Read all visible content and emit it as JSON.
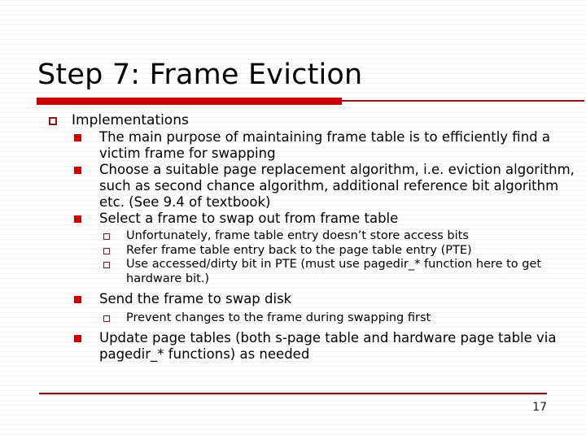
{
  "slide": {
    "title": "Step 7: Frame Eviction",
    "page_number": "17",
    "accent_color": "#CC0000",
    "rule_color": "#8C1616",
    "text_color": "#000000",
    "background_color": "#FFFFFF"
  },
  "bullets": {
    "b1": {
      "level": 1,
      "marker": "hollow-square",
      "text": "Implementations"
    },
    "b2": {
      "level": 2,
      "marker": "filled-square",
      "text": "The main purpose of maintaining frame table is to efficiently find a victim frame for swapping"
    },
    "b3": {
      "level": 2,
      "marker": "filled-square",
      "text": "Choose a suitable page replacement algorithm, i.e. eviction algorithm, such as second chance algorithm, additional reference bit algorithm etc. (See 9.4 of textbook)"
    },
    "b4": {
      "level": 2,
      "marker": "filled-square",
      "text": "Select a frame to swap out from frame table"
    },
    "b5": {
      "level": 3,
      "marker": "hollow-square",
      "text": "Unfortunately, frame table entry doesn’t store access bits"
    },
    "b6": {
      "level": 3,
      "marker": "hollow-square",
      "text": "Refer frame table entry back to the page table entry (PTE)"
    },
    "b7": {
      "level": 3,
      "marker": "hollow-square",
      "text": "Use accessed/dirty bit in PTE (must use pagedir_* function here to get hardware bit.)"
    },
    "b8": {
      "level": 2,
      "marker": "filled-square",
      "text": "Send the frame to swap disk"
    },
    "b9": {
      "level": 3,
      "marker": "hollow-square",
      "text": "Prevent changes to the frame during swapping first"
    },
    "b10": {
      "level": 2,
      "marker": "filled-square",
      "text": "Update page tables (both s-page table and hardware page table via pagedir_* functions) as needed"
    }
  }
}
